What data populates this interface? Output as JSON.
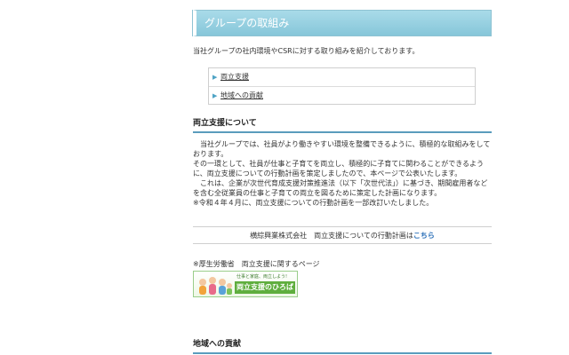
{
  "page_title": "グループの取組み",
  "intro": "当社グループの社内環境やCSRに対する取り組みを紹介しております。",
  "toc": [
    {
      "label": "両立支援"
    },
    {
      "label": "地域への貢献"
    }
  ],
  "section1": {
    "heading": "両立支援について",
    "paragraphs": [
      "　当社グループでは、社員がより働きやすい環境を整備できるように、積極的な取組みをしております。",
      "その一環として、社員が仕事と子育てを両立し、積極的に子育てに関わることができるように、両立支援についての行動計画を策定しましたので、本ページで公表いたします。",
      "　これは、企業が次世代育成支援対策推進法（以下「次世代法」）に基づき、期間雇用者などを含む全従業員の仕事と子育ての両立を図るために策定した計画になります。",
      "※令和４年４月に、両立支援についての行動計画を一部改訂いたしました。"
    ],
    "notice_text": "横綜興業株式会社　両立支援についての行動計画は",
    "notice_link": "こちら",
    "mhlw_label": "※厚生労働省　両立支援に関するページ",
    "banner_tagline": "仕事と家庭、両立しよう!",
    "banner_title": "両立支援のひろば"
  },
  "section2": {
    "heading": "地域への貢献"
  },
  "colors": {
    "title_bar": "#9fd3e3",
    "heading_rule": "#5a9cbd",
    "link": "#2a6fb8",
    "banner_green": "#5fae3e"
  }
}
